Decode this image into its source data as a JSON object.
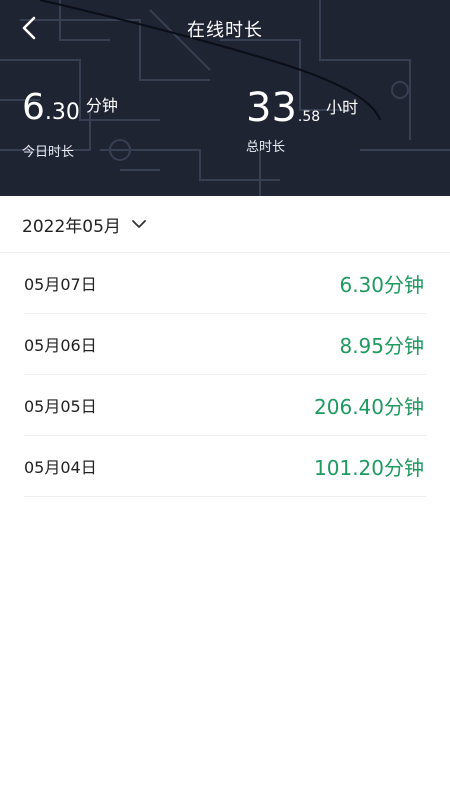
{
  "header": {
    "title": "在线时长",
    "today": {
      "int": "6",
      "dec": ".30",
      "unit": "分钟",
      "caption": "今日时长"
    },
    "total": {
      "int": "33",
      "dec": ".58",
      "unit": "小时",
      "caption": "总时长"
    }
  },
  "filter": {
    "month": "2022年05月"
  },
  "records": [
    {
      "date": "05月07日",
      "value": "6.30分钟"
    },
    {
      "date": "05月06日",
      "value": "8.95分钟"
    },
    {
      "date": "05月05日",
      "value": "206.40分钟"
    },
    {
      "date": "05月04日",
      "value": "101.20分钟"
    }
  ],
  "colors": {
    "header_bg": "#1f2433",
    "accent_green": "#1f9a5f"
  },
  "icons": {
    "back": "chevron-left-icon",
    "dropdown": "chevron-down-icon"
  }
}
